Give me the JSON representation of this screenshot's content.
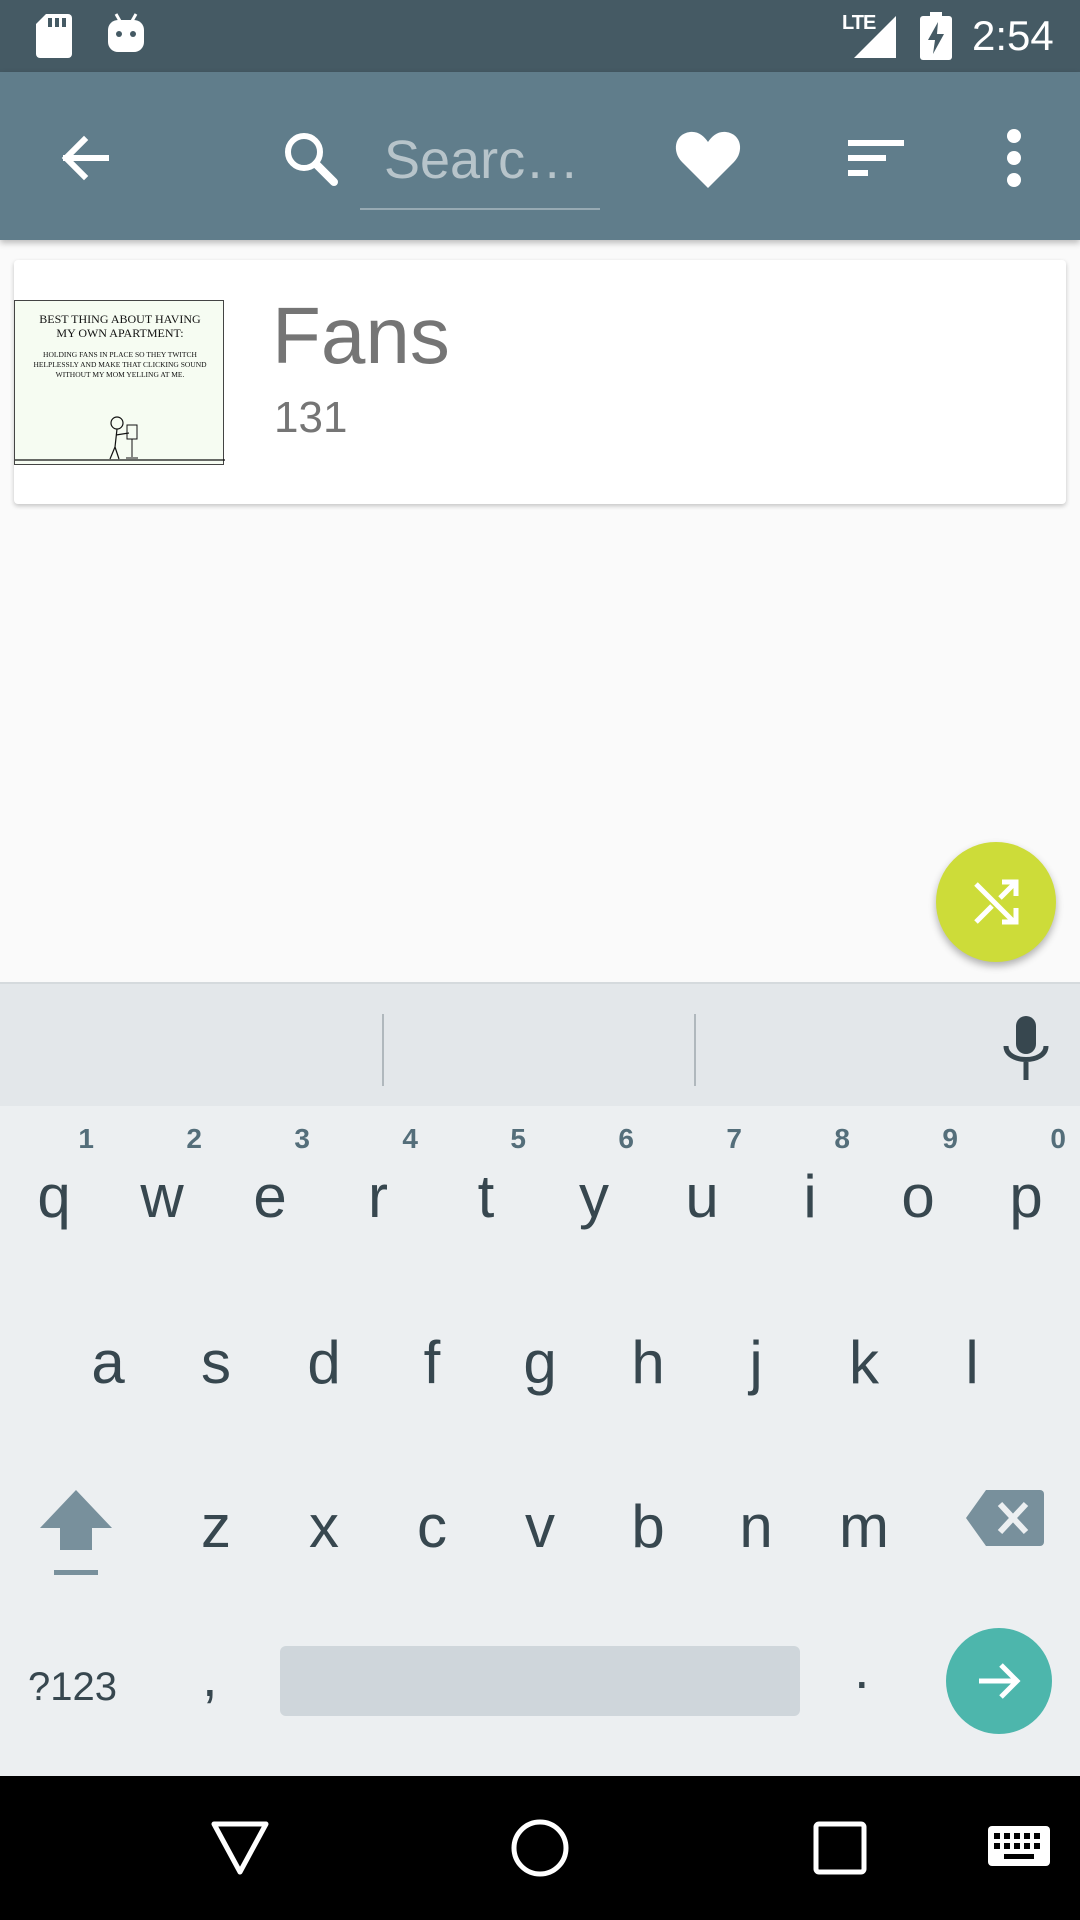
{
  "status_bar": {
    "time": "2:54",
    "network": "LTE",
    "icons": [
      "sd-card-icon",
      "android-icon",
      "signal-icon",
      "battery-charging-icon"
    ]
  },
  "toolbar": {
    "search_placeholder": "Searc…",
    "icons": [
      "back-arrow-icon",
      "search-icon",
      "heart-icon",
      "sort-icon",
      "more-vert-icon"
    ]
  },
  "results": [
    {
      "title": "Fans",
      "number": "131",
      "thumbnail_text": [
        "BEST THING ABOUT HAVING",
        "MY OWN APARTMENT:",
        "HOLDING FANS IN PLACE SO THEY TWITCH",
        "HELPLESSLY AND MAKE THAT CLICKING SOUND",
        "WITHOUT MY MOM YELLING AT ME."
      ]
    }
  ],
  "fab": {
    "icon": "shuffle-icon"
  },
  "keyboard": {
    "row1": [
      {
        "letter": "q",
        "hint": "1"
      },
      {
        "letter": "w",
        "hint": "2"
      },
      {
        "letter": "e",
        "hint": "3"
      },
      {
        "letter": "r",
        "hint": "4"
      },
      {
        "letter": "t",
        "hint": "5"
      },
      {
        "letter": "y",
        "hint": "6"
      },
      {
        "letter": "u",
        "hint": "7"
      },
      {
        "letter": "i",
        "hint": "8"
      },
      {
        "letter": "o",
        "hint": "9"
      },
      {
        "letter": "p",
        "hint": "0"
      }
    ],
    "row2": [
      "a",
      "s",
      "d",
      "f",
      "g",
      "h",
      "j",
      "k",
      "l"
    ],
    "row3": [
      "z",
      "x",
      "c",
      "v",
      "b",
      "n",
      "m"
    ],
    "symbols_label": "?123",
    "comma": ",",
    "period": "."
  },
  "colors": {
    "status_bar": "#455a64",
    "toolbar": "#607d8b",
    "fab": "#cddc39",
    "go_button": "#4db6ac",
    "keyboard_bg": "#eceff1"
  }
}
